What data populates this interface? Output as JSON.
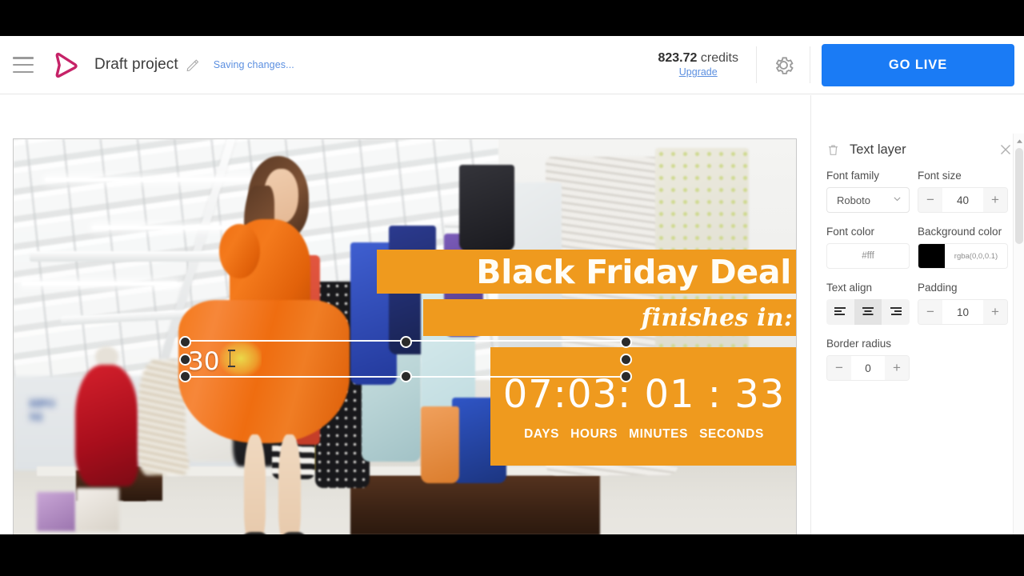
{
  "header": {
    "menu_icon": "hamburger-icon",
    "logo_icon": "play-triangle-logo",
    "project_name": "Draft project",
    "edit_icon": "pencil-icon",
    "status_text": "Saving changes...",
    "credits_amount": "823.72",
    "credits_label": "credits",
    "upgrade_link": "Upgrade",
    "settings_icon": "gear-icon",
    "go_live_label": "GO LIVE",
    "accent_blue": "#1a7bf5",
    "logo_color": "#c62368",
    "link_color": "#5b8fe0"
  },
  "canvas": {
    "overlay_title": "Black Friday Deal",
    "overlay_subtitle": "finishes in:",
    "countdown_digits": "07:03: 01 : 33",
    "countdown_labels": [
      "DAYS",
      "HOURS",
      "MINUTES",
      "SECONDS"
    ],
    "overlay_color": "#ef9a1e",
    "selected_layer_text": "30",
    "cursor_icon": "text-ibeam-cursor"
  },
  "panel": {
    "delete_icon": "trash-icon",
    "title": "Text layer",
    "close_icon": "close-icon",
    "font_family_label": "Font family",
    "font_family_value": "Roboto",
    "font_family_chevron": "chevron-down-icon",
    "font_size_label": "Font size",
    "font_size_value": "40",
    "font_color_label": "Font color",
    "font_color_value": "#fff",
    "background_color_label": "Background color",
    "background_color_value": "rgba(0,0,0.1)",
    "background_swatch_hex": "#000000",
    "text_align_label": "Text align",
    "text_align_options": [
      "align-left-icon",
      "align-center-icon",
      "align-right-icon"
    ],
    "text_align_selected": "align-center-icon",
    "padding_label": "Padding",
    "padding_value": "10",
    "border_radius_label": "Border radius",
    "border_radius_value": "0",
    "minus_label": "−",
    "plus_label": "+",
    "scroll_up_icon": "caret-up-icon"
  }
}
